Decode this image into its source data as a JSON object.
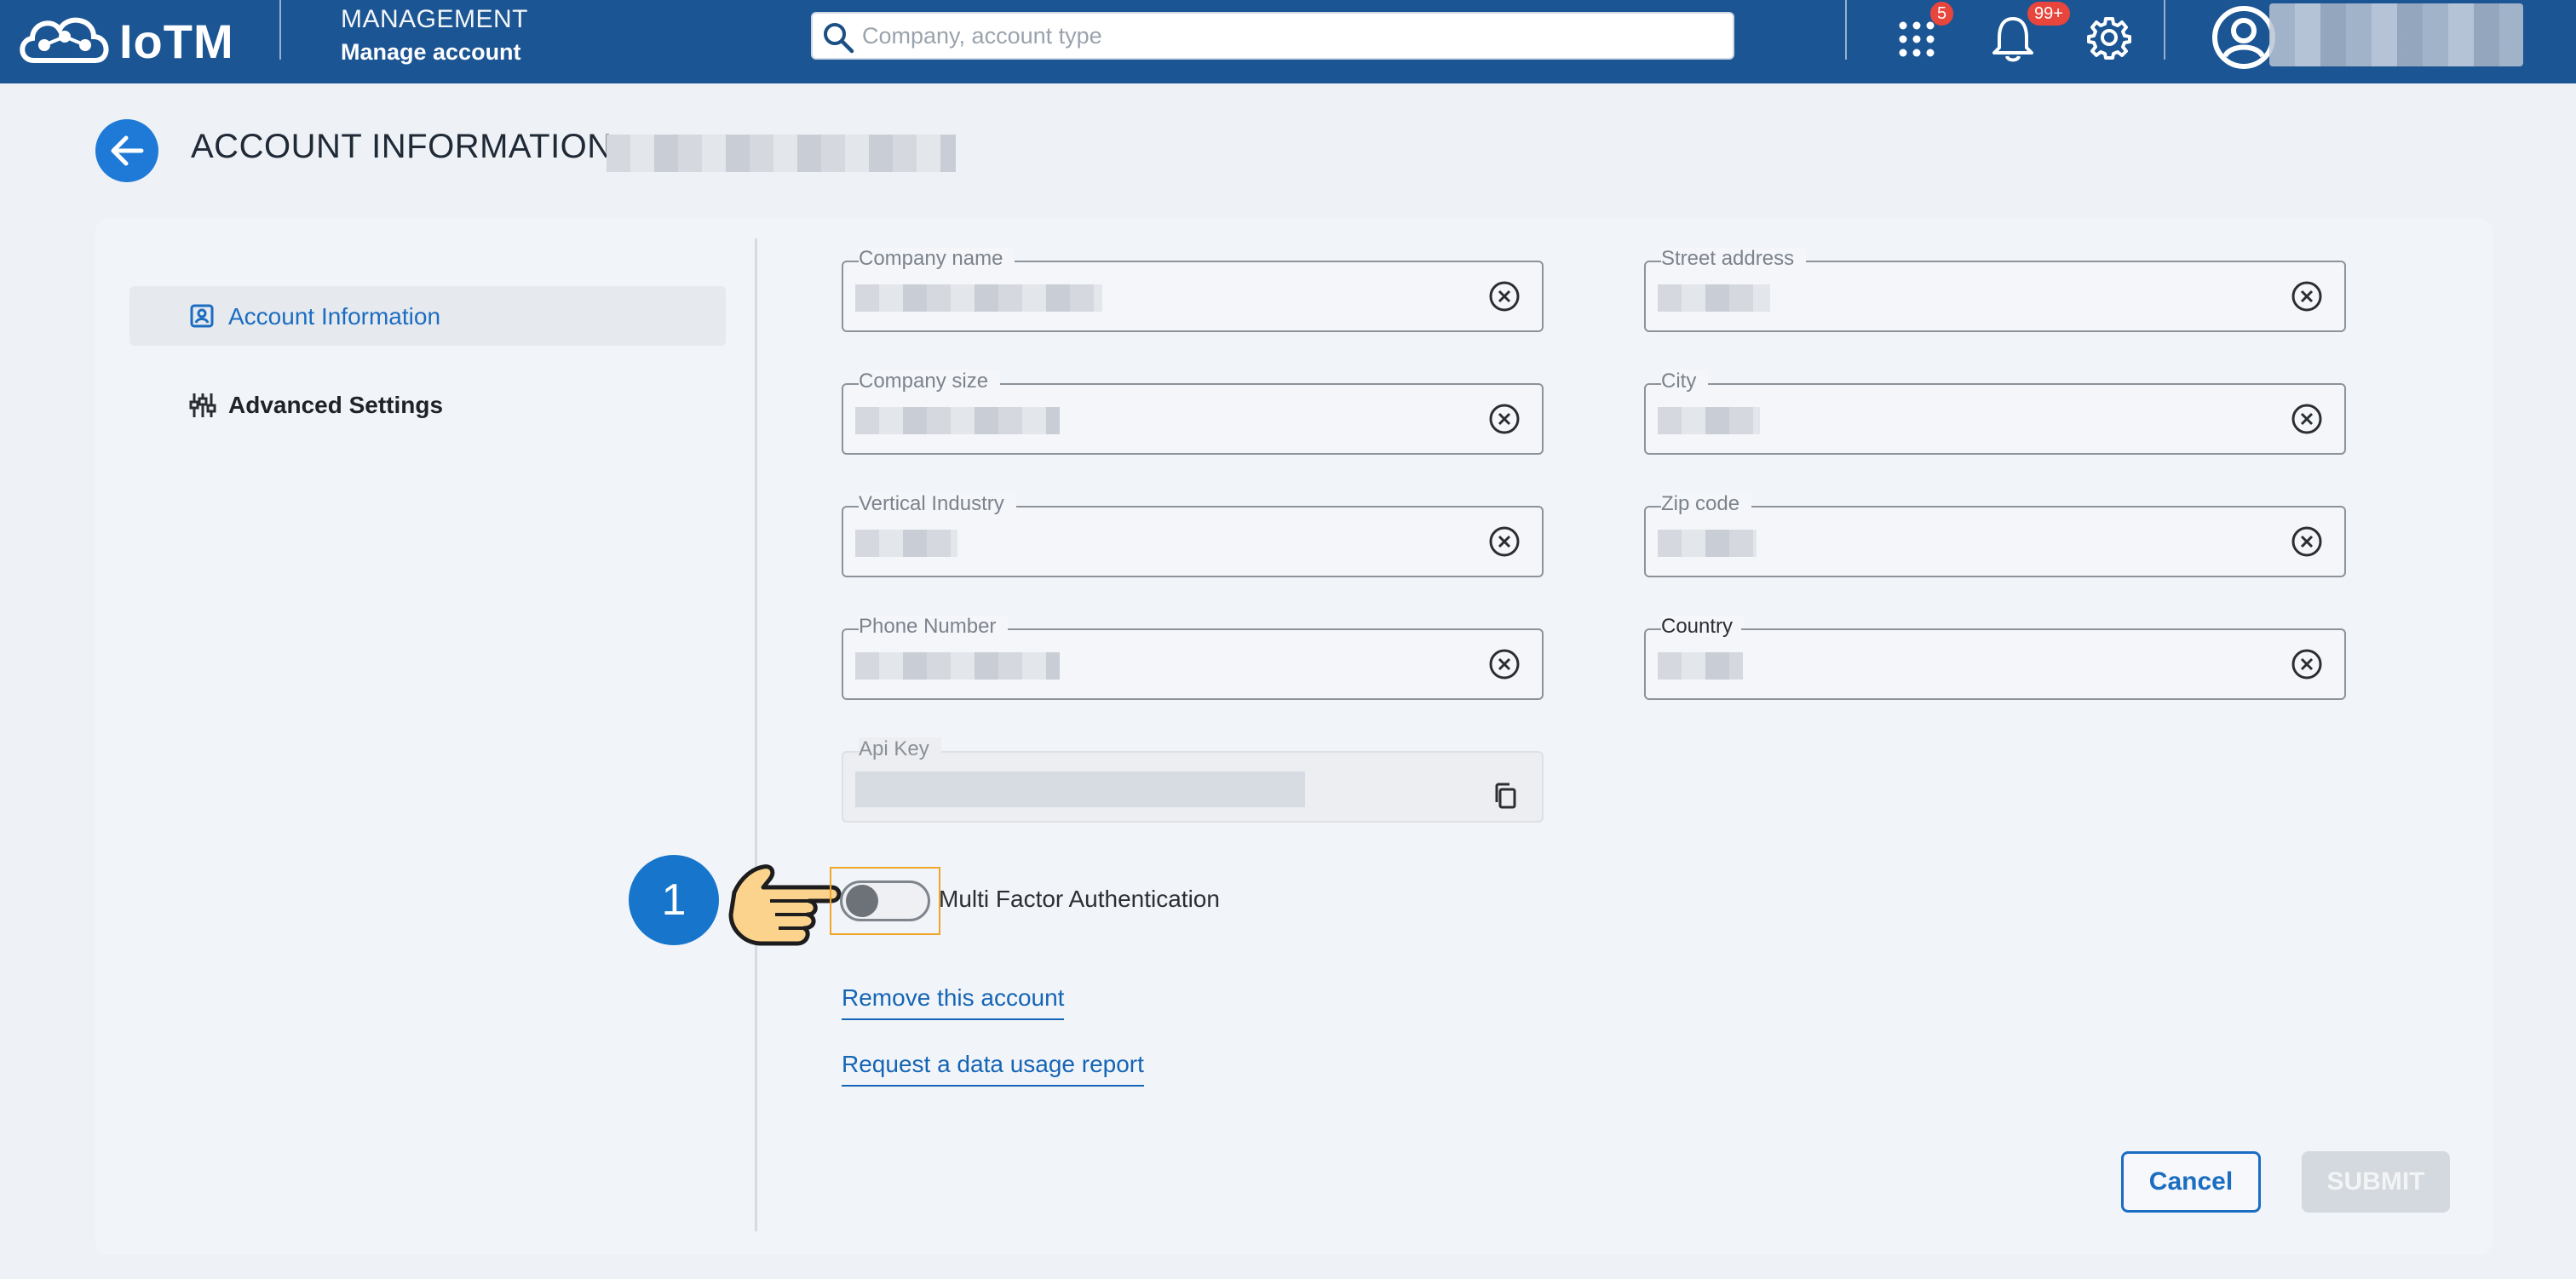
{
  "header": {
    "logo_text": "IoTM",
    "section_title": "MANAGEMENT",
    "section_subtitle": "Manage account",
    "search_placeholder": "Company, account type",
    "apps_badge": "5",
    "notifications_badge": "99+",
    "icons": [
      "apps-grid-icon",
      "bell-icon",
      "gear-icon",
      "user-avatar-icon"
    ]
  },
  "page": {
    "title": "ACCOUNT INFORMATION:"
  },
  "sidebar": {
    "items": [
      {
        "label": "Account Information",
        "icon": "id-card-icon",
        "active": true
      },
      {
        "label": "Advanced Settings",
        "icon": "sliders-icon",
        "active": false
      }
    ]
  },
  "form": {
    "fields": {
      "company_name": "Company name",
      "street_address": "Street address",
      "company_size": "Company size",
      "city": "City",
      "vertical_industry": "Vertical Industry",
      "zip_code": "Zip code",
      "phone_number": "Phone Number",
      "country": "Country",
      "api_key": "Api Key"
    },
    "mfa_label": "Multi Factor Authentication",
    "mfa_enabled": false,
    "remove_account": "Remove this account",
    "request_report": "Request a data usage report",
    "cancel": "Cancel",
    "submit": "SUBMIT"
  },
  "annotation": {
    "step_number": "1"
  },
  "colors": {
    "header_bg": "#1b5593",
    "accent": "#1e7ad6",
    "link": "#1565b5",
    "badge": "#e8453c",
    "highlight": "#f0a62b"
  }
}
